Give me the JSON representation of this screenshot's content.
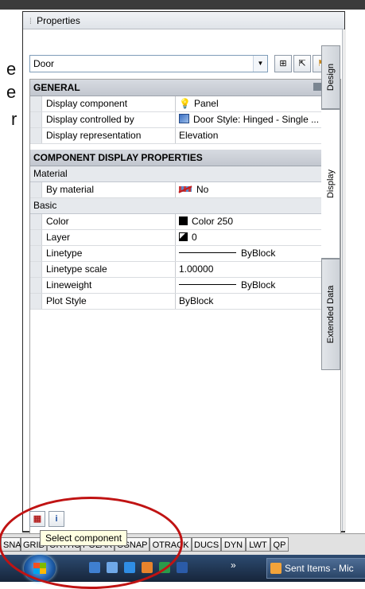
{
  "background_doc": {
    "chars": [
      "e",
      "e",
      "r"
    ]
  },
  "palette": {
    "title": "Properties",
    "combo_value": "Door",
    "toolbar_icons": [
      "quick-select-icon",
      "select-objects-icon",
      "toggle-pickadd-icon"
    ],
    "tabs": [
      "Design",
      "Display",
      "Extended Data"
    ],
    "active_tab": "Display"
  },
  "general": {
    "header": "GENERAL",
    "rows": [
      {
        "name": "Display component",
        "value": "Panel"
      },
      {
        "name": "Display controlled by",
        "value": "Door Style: Hinged - Single ..."
      },
      {
        "name": "Display representation",
        "value": "Elevation"
      }
    ]
  },
  "component": {
    "header": "COMPONENT DISPLAY PROPERTIES",
    "material_header": "Material",
    "material_rows": [
      {
        "name": "By material",
        "value": "No"
      }
    ],
    "basic_header": "Basic",
    "basic_rows": [
      {
        "name": "Color",
        "value": "Color 250"
      },
      {
        "name": "Layer",
        "value": "0"
      },
      {
        "name": "Linetype",
        "value": "ByBlock"
      },
      {
        "name": "Linetype scale",
        "value": "1.00000"
      },
      {
        "name": "Lineweight",
        "value": "ByBlock"
      },
      {
        "name": "Plot Style",
        "value": "ByBlock"
      }
    ]
  },
  "bottom_buttons": [
    "select-component-icon",
    "info-icon"
  ],
  "tooltip": "Select component",
  "statusbar": [
    "SNA",
    "GRID",
    "ORTHO",
    "POLAR",
    "OSNAP",
    "OTRACK",
    "DUCS",
    "DYN",
    "LWT",
    "QP"
  ],
  "taskbar": {
    "task_label": "Sent Items - Mic",
    "chevron": "»"
  },
  "colors": {
    "annotation_ring": "#c01313",
    "header_bg": "#c2c7cf",
    "tooltip_bg": "#ffffe1"
  }
}
